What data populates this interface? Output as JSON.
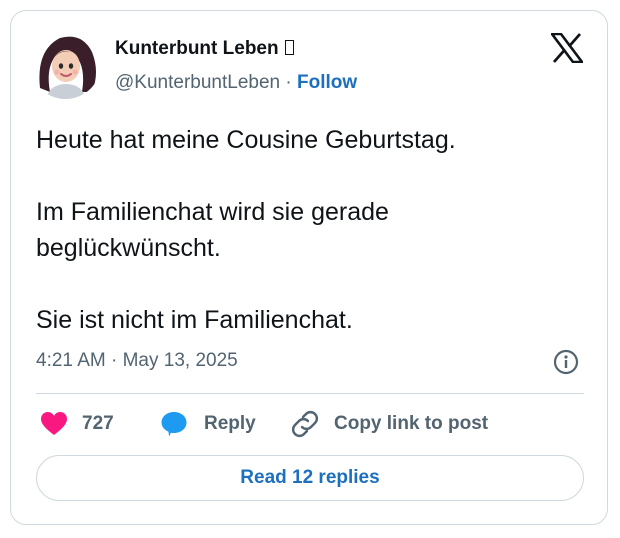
{
  "author": {
    "display_name": "Kunterbunt Leben",
    "handle": "@KunterbuntLeben",
    "separator": "·",
    "follow_label": "Follow"
  },
  "tweet": {
    "paragraphs": [
      "Heute hat meine Cousine Geburtstag.",
      "Im Familienchat wird sie gerade beglückwünscht.",
      "Sie ist nicht im Familienchat."
    ],
    "timestamp": "4:21 AM · May 13, 2025"
  },
  "actions": {
    "like_count": "727",
    "reply_label": "Reply",
    "copy_link_label": "Copy link to post"
  },
  "read_replies_label": "Read 12 replies",
  "colors": {
    "accent": "#1d6fbf",
    "like": "#f91880",
    "reply_bubble": "#1d9bf0",
    "muted": "#536471",
    "border": "#cfd9de"
  },
  "icons": [
    "avatar",
    "emoji-placeholder-icon",
    "x-logo-icon",
    "info-icon",
    "heart-icon",
    "reply-bubble-icon",
    "link-icon"
  ]
}
